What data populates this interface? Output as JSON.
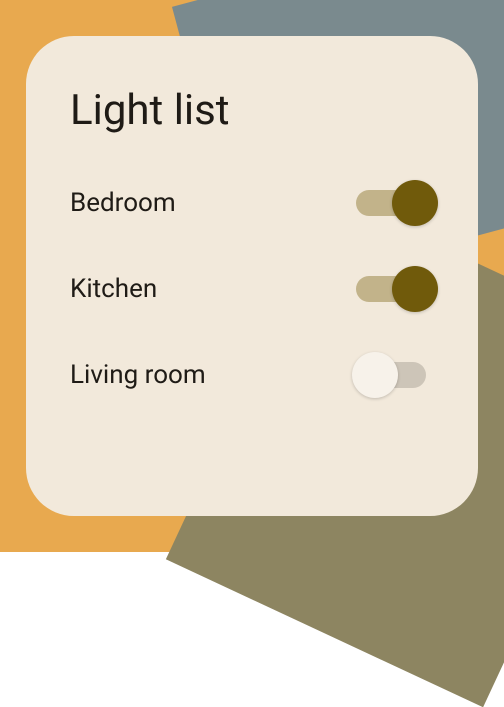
{
  "title": "Light list",
  "lights": [
    {
      "label": "Bedroom",
      "on": true
    },
    {
      "label": "Kitchen",
      "on": true
    },
    {
      "label": "Living room",
      "on": false
    }
  ]
}
